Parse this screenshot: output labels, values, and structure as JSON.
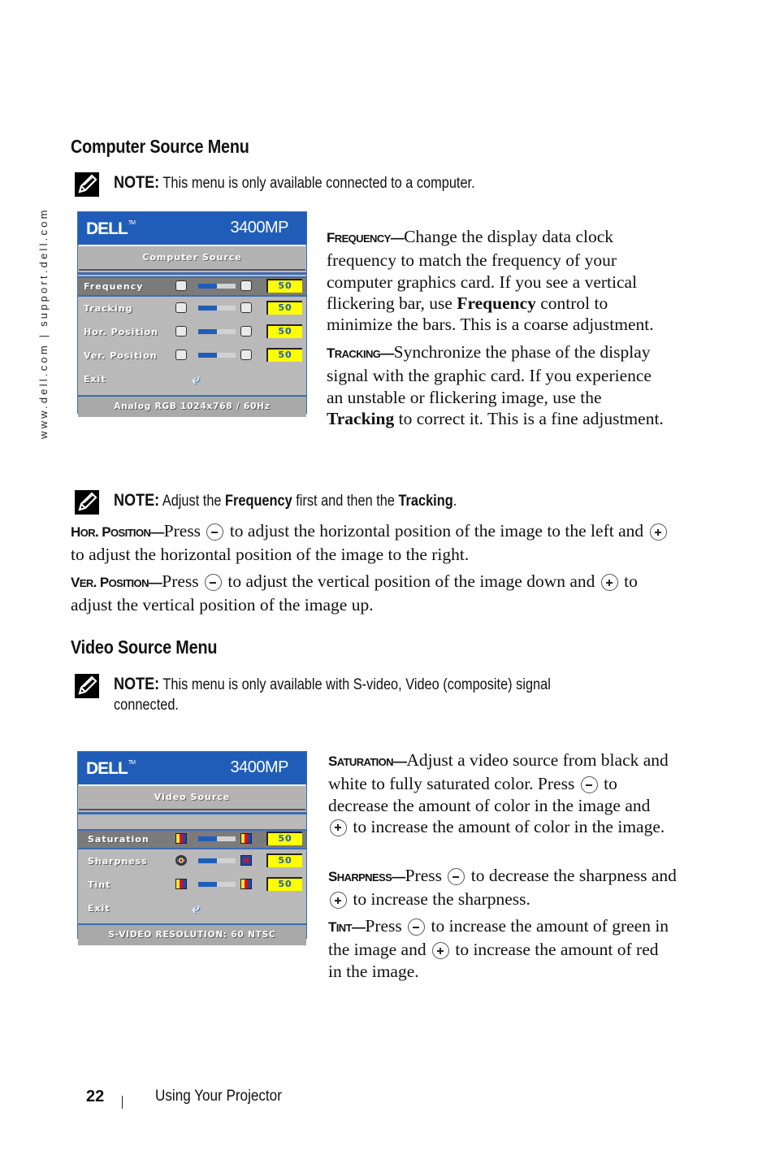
{
  "side_url": "www.dell.com | support.dell.com",
  "computer_section": {
    "heading": "Computer Source Menu",
    "note": {
      "label": "NOTE:",
      "text": " This menu is only available connected to a computer."
    },
    "osd": {
      "brand": "DELL",
      "trademark": "TM",
      "model": "3400MP",
      "title": "Computer Source",
      "rows": [
        {
          "label": "Frequency",
          "value": "50",
          "level": 0.5,
          "selected": true,
          "icon_left": "frequency-minus-icon",
          "icon_right": "frequency-plus-icon"
        },
        {
          "label": "Tracking",
          "value": "50",
          "level": 0.5,
          "selected": false,
          "icon_left": "tracking-minus-icon",
          "icon_right": "tracking-plus-icon"
        },
        {
          "label": "Hor. Position",
          "value": "50",
          "level": 0.5,
          "selected": false,
          "icon_left": "move-left-icon",
          "icon_right": "move-right-icon"
        },
        {
          "label": "Ver. Position",
          "value": "50",
          "level": 0.5,
          "selected": false,
          "icon_left": "move-down-icon",
          "icon_right": "move-up-icon"
        }
      ],
      "exit_label": "Exit",
      "exit_icon": "return-arrow-icon",
      "status": "Analog RGB 1024x768 / 60Hz"
    },
    "frequency": {
      "term": "Frequency",
      "dash": "—",
      "text1": "Change the display data clock frequency to match the frequency of your computer graphics card. If you see a vertical flickering bar, use ",
      "bold": "Frequency",
      "text2": " control to minimize the bars. This is a coarse adjustment."
    },
    "tracking": {
      "term": "Tracking",
      "dash": "—",
      "text1": "Synchronize the phase of the display signal with the graphic card. If you experience an unstable or flickering image, use the ",
      "bold": "Tracking",
      "text2": " to correct it. This is a fine adjustment."
    },
    "note2": {
      "label": "NOTE:",
      "t1": " Adjust the ",
      "b1": "Frequency",
      "t2": " first and then the ",
      "b2": "Tracking",
      "t3": "."
    },
    "hor_position": {
      "term": "Hor. Position",
      "dash": "—",
      "t1": "Press ",
      "t2": " to adjust the horizontal position of the image to the left and ",
      "t3": " to adjust the horizontal position of the image to the right."
    },
    "ver_position": {
      "term": "Ver. Position",
      "dash": "—",
      "t1": "Press ",
      "t2": " to adjust the vertical position of the image down and ",
      "t3": " to adjust the vertical position of the image up."
    }
  },
  "video_section": {
    "heading": "Video Source Menu",
    "note": {
      "label": "NOTE:",
      "line1": " This menu is only available with S-video, Video (composite) signal",
      "line2": "connected."
    },
    "osd": {
      "brand": "DELL",
      "trademark": "TM",
      "model": "3400MP",
      "title": "Video Source",
      "rows": [
        {
          "label": "Saturation",
          "value": "50",
          "level": 0.5,
          "selected": true
        },
        {
          "label": "Sharpness",
          "value": "50",
          "level": 0.5,
          "selected": false
        },
        {
          "label": "Tint",
          "value": "50",
          "level": 0.5,
          "selected": false
        }
      ],
      "exit_label": "Exit",
      "status": "S-VIDEO RESOLUTION: 60 NTSC"
    },
    "saturation": {
      "term": "Saturation",
      "dash": "—",
      "t1": "Adjust a video source from black and white to fully saturated color. Press ",
      "t2": " to decrease the amount of color in the image and ",
      "t3": " to increase the amount of color in the image."
    },
    "sharpness": {
      "term": "Sharpness",
      "dash": "—",
      "t1": "Press ",
      "t2": " to decrease the sharpness and ",
      "t3": " to increase the sharpness."
    },
    "tint": {
      "term": "Tint",
      "dash": "—",
      "t1": "Press ",
      "t2": " to increase the amount of green in the image and ",
      "t3": " to increase the amount of red in the image."
    }
  },
  "footer": {
    "page_number": "22",
    "chapter": "Using Your Projector"
  }
}
